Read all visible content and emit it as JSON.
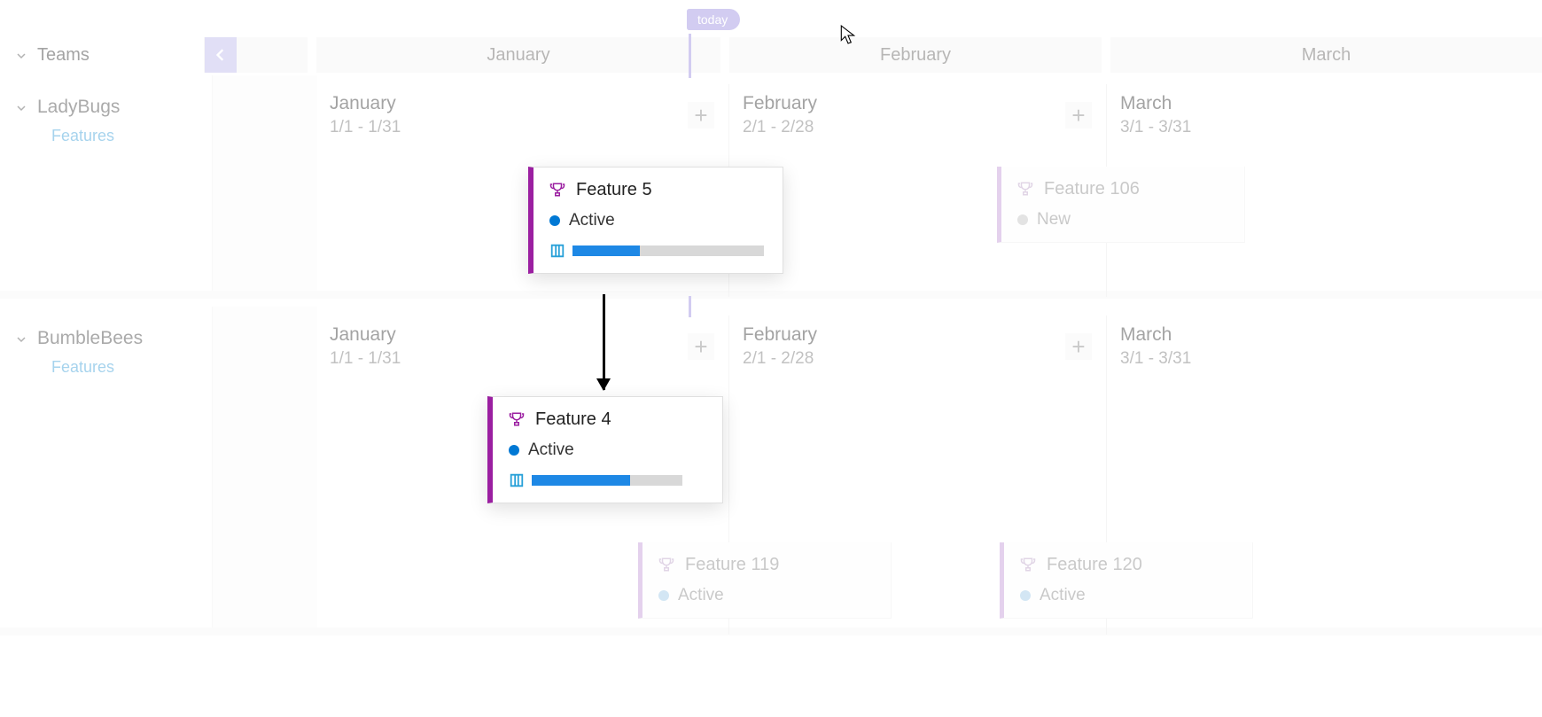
{
  "today_label": "today",
  "sidebar_header": "Teams",
  "months_header": [
    "January",
    "February",
    "March"
  ],
  "lanes": [
    {
      "team": "LadyBugs",
      "features_label": "Features",
      "columns": [
        {
          "title": "January",
          "range": "1/1 - 1/31"
        },
        {
          "title": "February",
          "range": "2/1 - 2/28"
        },
        {
          "title": "March",
          "range": "3/1 - 3/31"
        }
      ]
    },
    {
      "team": "BumbleBees",
      "features_label": "Features",
      "columns": [
        {
          "title": "January",
          "range": "1/1 - 1/31"
        },
        {
          "title": "February",
          "range": "2/1 - 2/28"
        },
        {
          "title": "March",
          "range": "3/1 - 3/31"
        }
      ]
    }
  ],
  "cards": {
    "feature5": {
      "title": "Feature 5",
      "state": "Active",
      "progress_pct": 35
    },
    "feature106": {
      "title": "Feature 106",
      "state": "New"
    },
    "feature4": {
      "title": "Feature 4",
      "state": "Active",
      "progress_pct": 65
    },
    "feature119": {
      "title": "Feature 119",
      "state": "Active"
    },
    "feature120": {
      "title": "Feature 120",
      "state": "Active"
    }
  },
  "colors": {
    "accent_purple": "#9b1fa1",
    "accent_blue": "#0078d4",
    "today_purple": "#9b8fe0"
  }
}
